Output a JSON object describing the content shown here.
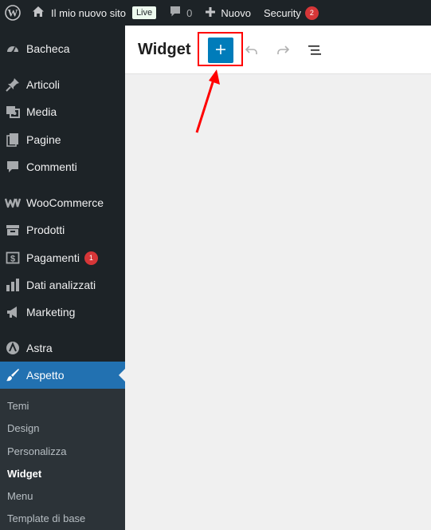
{
  "adminbar": {
    "site_name": "Il mio nuovo sito",
    "live_label": "Live",
    "comments_count": "0",
    "new_label": "Nuovo",
    "security_label": "Security",
    "security_count": "2"
  },
  "sidebar": {
    "items": [
      {
        "label": "Bacheca",
        "icon": "dashboard-icon"
      },
      {
        "label": "Articoli",
        "icon": "pin-icon"
      },
      {
        "label": "Media",
        "icon": "media-icon"
      },
      {
        "label": "Pagine",
        "icon": "pages-icon"
      },
      {
        "label": "Commenti",
        "icon": "comment-icon"
      },
      {
        "label": "WooCommerce",
        "icon": "woocommerce-icon"
      },
      {
        "label": "Prodotti",
        "icon": "archive-icon"
      },
      {
        "label": "Pagamenti",
        "icon": "payment-icon",
        "badge": "1"
      },
      {
        "label": "Dati analizzati",
        "icon": "analytics-icon"
      },
      {
        "label": "Marketing",
        "icon": "megaphone-icon"
      },
      {
        "label": "Astra",
        "icon": "astra-icon"
      },
      {
        "label": "Aspetto",
        "icon": "brush-icon"
      }
    ],
    "submenu": [
      {
        "label": "Temi"
      },
      {
        "label": "Design"
      },
      {
        "label": "Personalizza"
      },
      {
        "label": "Widget"
      },
      {
        "label": "Menu"
      },
      {
        "label": "Template di base"
      }
    ]
  },
  "header": {
    "title": "Widget",
    "inserter_icon": "plus-icon",
    "undo_icon": "undo-icon",
    "redo_icon": "redo-icon",
    "list_view_icon": "list-view-icon"
  },
  "colors": {
    "adminbar_bg": "#1d2327",
    "accent": "#2271b1",
    "inserter": "#007cba",
    "badge": "#d63638",
    "annotation": "#ff0000"
  }
}
